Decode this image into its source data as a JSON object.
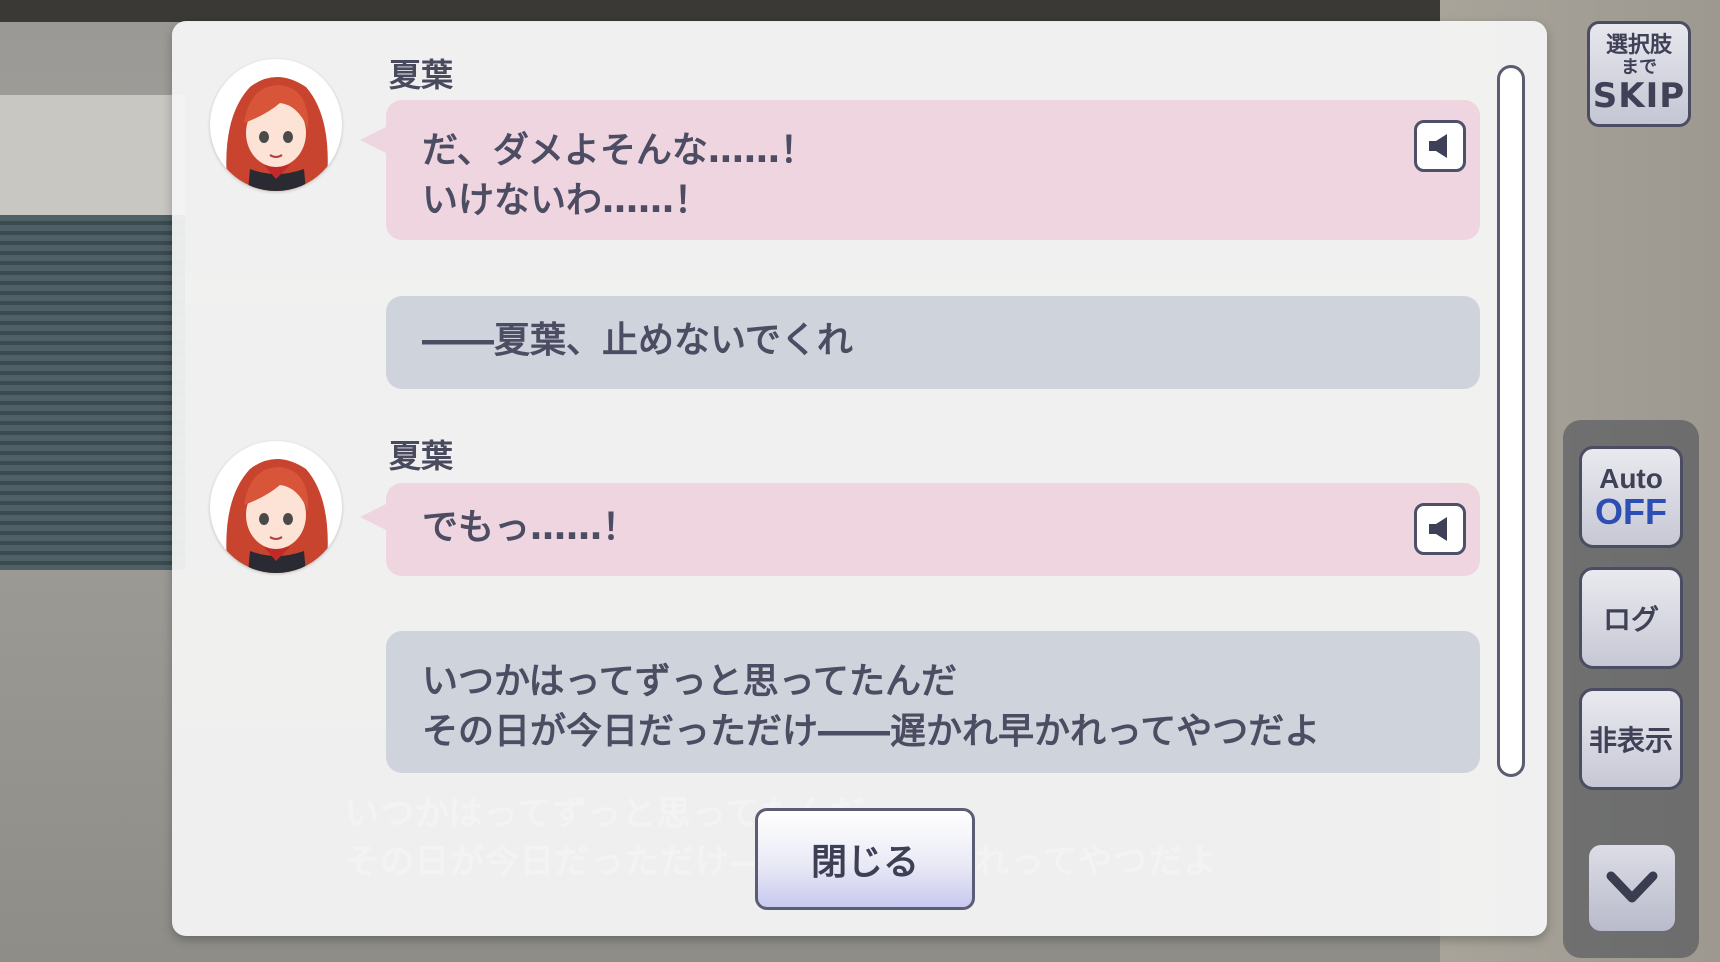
{
  "log": {
    "entries": [
      {
        "speaker": "夏葉",
        "lines": [
          "だ、ダメよそんな……！",
          "いけないわ……！"
        ]
      },
      {
        "lines": [
          "――夏葉、止めないでくれ"
        ]
      },
      {
        "speaker": "夏葉",
        "lines": [
          "でもっ……！"
        ]
      },
      {
        "lines": [
          "いつかはってずっと思ってたんだ",
          "その日が今日だっただけ――遅かれ早かれってやつだよ"
        ]
      }
    ],
    "close_label": "閉じる"
  },
  "controls": {
    "skip": {
      "line1": "選択肢",
      "line2": "まで",
      "line3": "SKIP"
    },
    "auto": {
      "label": "Auto",
      "state": "OFF"
    },
    "log_label": "ログ",
    "hide_label": "非表示"
  },
  "colors": {
    "pink_bubble": "#eed5e0",
    "gray_bubble": "#cfd4dc",
    "auto_off": "#2d4fb4"
  },
  "icons": [
    "speaker-icon",
    "chevron-down-icon"
  ]
}
